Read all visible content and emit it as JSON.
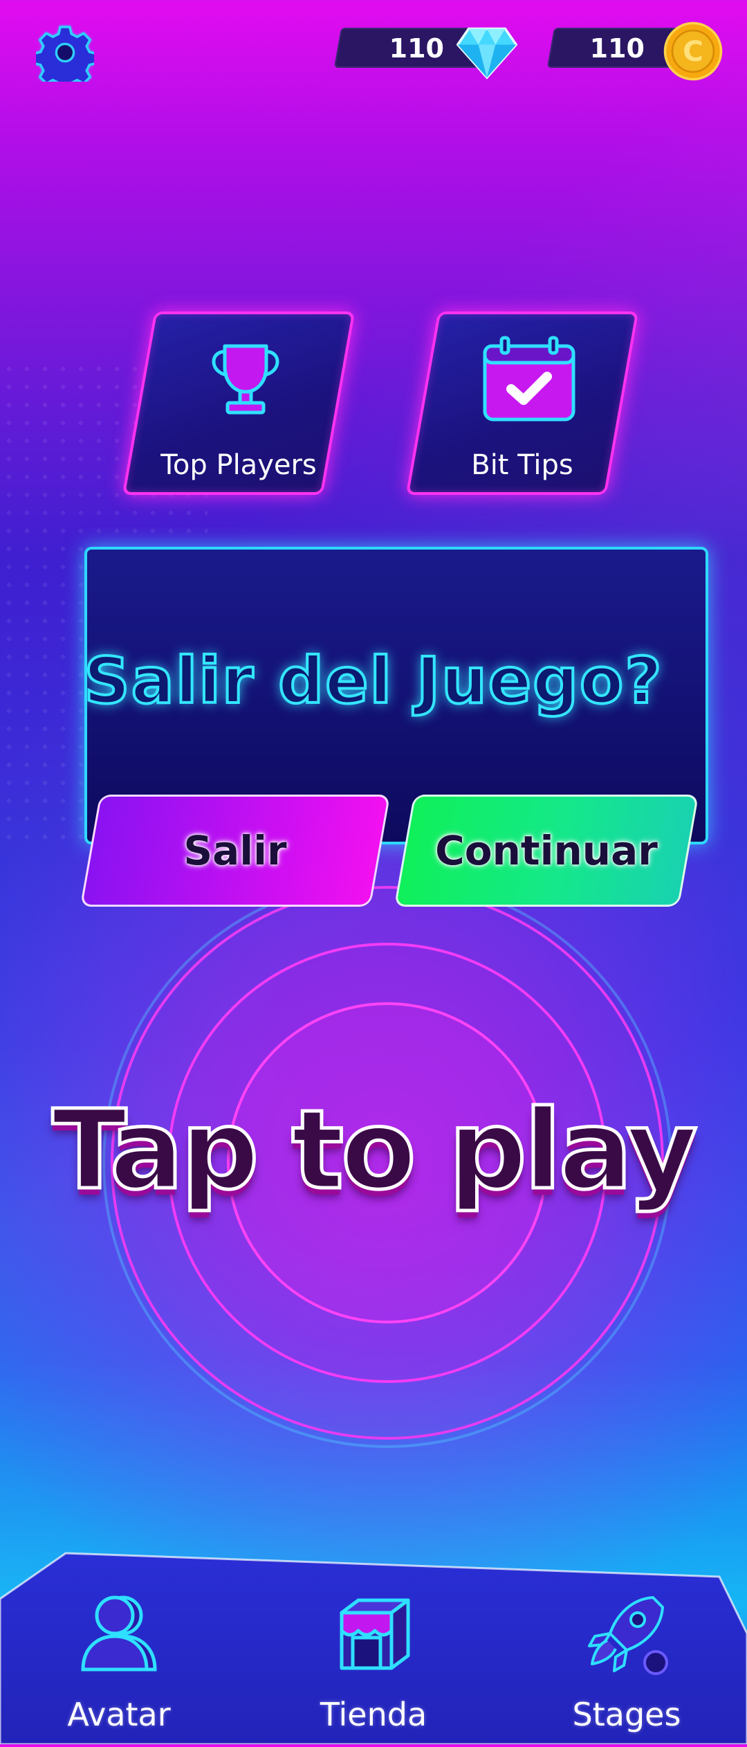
{
  "header": {
    "settings_icon": "gear-icon",
    "gems": {
      "value": "110",
      "icon": "diamond-icon"
    },
    "coins": {
      "value": "110",
      "icon": "coin-icon",
      "coin_symbol": "C"
    }
  },
  "menu": {
    "top_players": {
      "label": "Top Players",
      "icon": "trophy-icon"
    },
    "bit_tips": {
      "label": "Bit Tips",
      "icon": "calendar-check-icon"
    }
  },
  "dialog": {
    "title": "Salir del Juego?",
    "exit_label": "Salir",
    "continue_label": "Continuar"
  },
  "play": {
    "label": "Tap to play"
  },
  "nav": {
    "avatar": {
      "label": "Avatar",
      "icon": "person-icon"
    },
    "store": {
      "label": "Tienda",
      "icon": "store-box-icon"
    },
    "stages": {
      "label": "Stages",
      "icon": "rocket-icon"
    }
  },
  "colors": {
    "neon_pink": "#ff32f0",
    "neon_cyan": "#2fd8ff",
    "exit_button": "#a012f0",
    "continue_button": "#18e86a"
  }
}
